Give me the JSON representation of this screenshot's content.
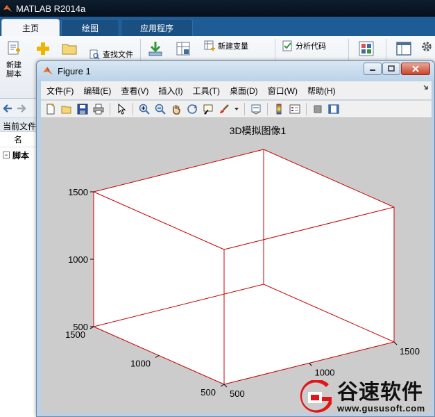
{
  "app": {
    "title": "MATLAB R2014a",
    "tabs": [
      "主页",
      "绘图",
      "应用程序"
    ]
  },
  "ribbon": {
    "new_script": "新建\n脚本",
    "new_script_line1": "新建",
    "new_script_line2": "脚本",
    "find_files": "查找文件",
    "new_variable": "新建变量",
    "analyze_code": "分析代码"
  },
  "left_panel": {
    "current_folder": "当前文件夹",
    "name_col": "名",
    "scripts_node": "脚本",
    "toggle": "−"
  },
  "figure": {
    "title": "Figure 1",
    "menus": [
      "文件(F)",
      "编辑(E)",
      "查看(V)",
      "插入(I)",
      "工具(T)",
      "桌面(D)",
      "窗口(W)",
      "帮助(H)"
    ],
    "toolbar_icons": [
      "new-figure-icon",
      "open-icon",
      "save-icon",
      "print-icon",
      "pointer-icon",
      "zoom-in-icon",
      "zoom-out-icon",
      "pan-icon",
      "rotate-3d-icon",
      "data-cursor-icon",
      "brush-icon",
      "link-plot-icon",
      "colorbar-icon",
      "legend-icon",
      "hide-plot-tools-icon",
      "show-plot-tools-icon"
    ]
  },
  "chart_data": {
    "type": "box3d",
    "title": "3D模拟图像1",
    "xlim": [
      500,
      1500
    ],
    "ylim": [
      500,
      1500
    ],
    "zlim": [
      500,
      1500
    ],
    "x_ticks": [
      "500",
      "1000",
      "1500"
    ],
    "y_ticks": [
      "500",
      "1000",
      "1500"
    ],
    "z_ticks": [
      "500",
      "1000",
      "1500"
    ],
    "line_color": "#cc0000",
    "background": "#ffffff",
    "grid": false
  },
  "watermark": {
    "name": "谷速软件",
    "url": "www.gususoft.com",
    "color": "#e0161a"
  }
}
